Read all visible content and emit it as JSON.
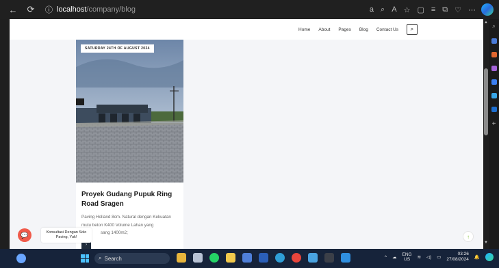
{
  "browser": {
    "url_host": "localhost",
    "url_path": "/company/blog",
    "back_icon": "arrow-left-icon",
    "refresh_icon": "refresh-icon",
    "info_icon": "info-icon"
  },
  "site_nav": {
    "items": [
      "Home",
      "About",
      "Pages",
      "Blog",
      "Contact Us"
    ],
    "search_icon": "search-icon"
  },
  "blog_card": {
    "date": "SATURDAY 24TH OF AUGUST 2024",
    "title": "Proyek Gudang Pupuk Ring Road Sragen",
    "excerpt_line1": "Paving Holland 8cm. Natural dengan Kekuatan",
    "excerpt_line2": "mutu beton K400 Volume Lahan yang",
    "excerpt_line3": "sang 1400m2;",
    "read_more_icon": "chevron-right-icon"
  },
  "chat_widget": {
    "line1": "Konsultasi Dengan Solo",
    "line2": "Paving, Yuk!"
  },
  "taskbar": {
    "search_label": "Search",
    "lang_top": "ENG",
    "lang_bottom": "US",
    "time": "03:26",
    "date": "27/08/2024"
  },
  "colors": {
    "accent_chat": "#f05a4a",
    "nav_dark": "#1f2b3a",
    "taskbar": "#16233a"
  }
}
